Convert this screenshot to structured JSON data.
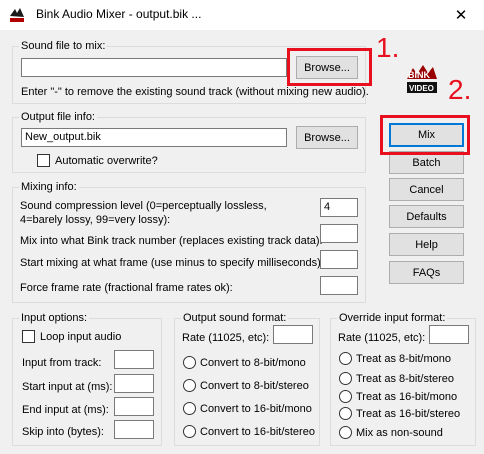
{
  "window": {
    "title": "Bink Audio Mixer - output.bik ...",
    "close_glyph": "✕",
    "icon": "bink-app-icon"
  },
  "sound_file": {
    "group_label": "Sound file to mix:",
    "value": "",
    "browse_label": "Browse...",
    "hint": "Enter \"-\" to remove the existing sound track (without mixing new audio)."
  },
  "logo": {
    "line1": "BINK",
    "line2": "VIDEO"
  },
  "output_file": {
    "group_label": "Output file info:",
    "value": "New_output.bik",
    "browse_label": "Browse...",
    "overwrite_label": "Automatic overwrite?",
    "overwrite_checked": false
  },
  "mixing": {
    "group_label": "Mixing info:",
    "compression_label": "Sound compression level (0=perceptually lossless, 4=barely lossy, 99=very lossy):",
    "compression_value": "4",
    "track_label": "Mix into what Bink track number (replaces existing track data):",
    "track_value": "",
    "start_frame_label": "Start mixing at what frame (use minus to specify milliseconds):",
    "start_frame_value": "",
    "frame_rate_label": "Force frame rate (fractional frame rates ok):",
    "frame_rate_value": ""
  },
  "side_buttons": {
    "mix": "Mix",
    "batch": "Batch",
    "cancel": "Cancel",
    "defaults": "Defaults",
    "help": "Help",
    "faqs": "FAQs"
  },
  "annotations": {
    "step1": "1.",
    "step2": "2.",
    "color": "#e8101e"
  },
  "input_options": {
    "group_label": "Input options:",
    "loop_label": "Loop input audio",
    "from_track_label": "Input from track:",
    "start_label": "Start input at (ms):",
    "end_label": "End input at (ms):",
    "skip_label": "Skip into (bytes):"
  },
  "output_sound": {
    "group_label": "Output sound format:",
    "rate_label": "Rate (11025, etc):",
    "options": [
      "Convert to 8-bit/mono",
      "Convert to 8-bit/stereo",
      "Convert to 16-bit/mono",
      "Convert to 16-bit/stereo"
    ]
  },
  "override_input": {
    "group_label": "Override input format:",
    "rate_label": "Rate (11025, etc):",
    "options": [
      "Treat as 8-bit/mono",
      "Treat as 8-bit/stereo",
      "Treat as 16-bit/mono",
      "Treat as 16-bit/stereo",
      "Mix as non-sound"
    ]
  }
}
